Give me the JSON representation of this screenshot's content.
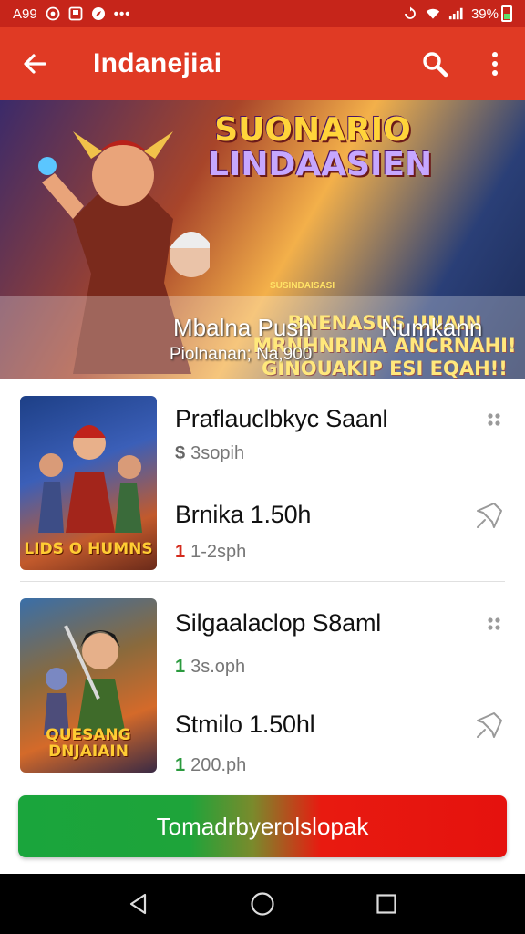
{
  "status_bar": {
    "time": "A99",
    "battery": "39%",
    "icons": [
      "sync-icon",
      "notification-icon",
      "compass-icon",
      "more-dots-icon",
      "rotate-icon",
      "wifi-icon",
      "signal-icon",
      "battery-icon"
    ]
  },
  "app_bar": {
    "title": "Indanejiai",
    "icons": [
      "back-arrow-icon",
      "search-icon",
      "overflow-menu-icon"
    ]
  },
  "banner": {
    "headline_line1": "SUONARIO",
    "headline_line2": "LINDAASIEN",
    "subheadline": "SUSINDAISASI",
    "promo_line1": "BNENASUS UNAIN",
    "promo_line2": "MRNHNRINA ANCRNAHI!",
    "promo_line3": "GINOUAKIP ESI EQAH!!",
    "stat_left": "Mbalna Push",
    "stat_right": "Numkann",
    "meta": "Piolnanan;  Na,900"
  },
  "games": [
    {
      "thumb_title": "LIDS O HUMNS",
      "rows": [
        {
          "title": "Praflauclbkyc Saanl",
          "price_lead": "$",
          "price": "3sopih"
        },
        {
          "title": "Brnika 1.50h",
          "price_lead": "1",
          "price": "1-2sph"
        }
      ]
    },
    {
      "thumb_title": "QUESANG DNJAIAIN",
      "rows": [
        {
          "title": "Silgaalaclop S8aml",
          "price_lead": "1",
          "price": "3s.oph"
        },
        {
          "title": "Stmilo 1.50hl",
          "price_lead": "1",
          "price": "200.ph"
        }
      ]
    }
  ],
  "action_button": {
    "label": "Tomadrbyerolslopak"
  },
  "nav_bar": {
    "icons": [
      "back-triangle-icon",
      "home-circle-icon",
      "recents-square-icon"
    ]
  },
  "colors": {
    "status_bar": "#c6251a",
    "app_bar": "#e03a24",
    "green": "#1ea43a",
    "red": "#e5120e",
    "nav_bar": "#000000"
  }
}
